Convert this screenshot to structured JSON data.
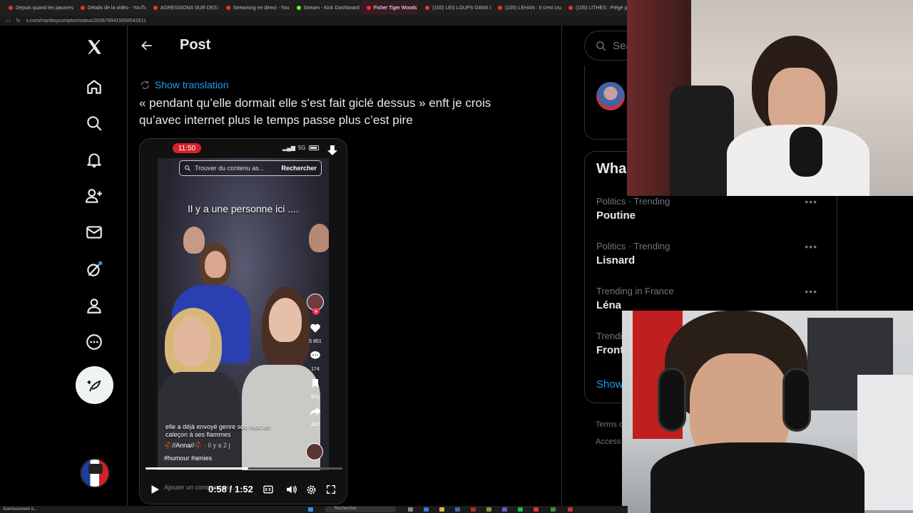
{
  "browser": {
    "tabs": [
      {
        "label": "Depuis quand les pauvres",
        "active": false
      },
      {
        "label": "Détails de la vidéo - YouTu",
        "active": false
      },
      {
        "label": "AGRESSIONS SUR DES E",
        "active": false
      },
      {
        "label": "Streaming en direct - You",
        "active": false
      },
      {
        "label": "Stream - Kick Dashboard",
        "active": false
      },
      {
        "label": "Fisher Tiger Woods",
        "active": true
      },
      {
        "label": "(105) LES LOUPS DANS L",
        "active": false
      },
      {
        "label": "(105) LEHAN : Il s'est cru",
        "active": false
      },
      {
        "label": "(105) LITHÉS : Piégé p",
        "active": false
      }
    ],
    "url": "x.com/manboycompton/status/2036789415058542611"
  },
  "nav": {
    "items": [
      {
        "name": "x-logo-icon"
      },
      {
        "name": "home-icon"
      },
      {
        "name": "search-icon"
      },
      {
        "name": "notifications-icon"
      },
      {
        "name": "follow-icon"
      },
      {
        "name": "messages-icon"
      },
      {
        "name": "grok-icon"
      },
      {
        "name": "profile-icon"
      },
      {
        "name": "more-icon"
      }
    ]
  },
  "post": {
    "header_title": "Post",
    "show_translation": "Show translation",
    "text": "« pendant qu’elle dormait elle s’est fait giclé dessus » enft je crois qu’avec internet plus le temps passe plus c’est pire",
    "video": {
      "status_time": "11:50",
      "network": "5G",
      "search_placeholder": "Trouver du contenu as...",
      "search_button": "Rechercher",
      "caption_top": "Il y a une personne ici ....",
      "caption_bottom": "elle a déjà envoyé genre son mec en caleçon à ses flammes",
      "author": "🥀//Anna//🥀",
      "author_sub": "· Il y a 2 j",
      "tags": "#humour #amies",
      "likes": "5 851",
      "comments": "174",
      "saves": "801",
      "shares": "682",
      "comment_placeholder": "Ajouter un commentaire...",
      "timecode": "0:58 / 1:52",
      "progress": 0.52
    }
  },
  "sidebar": {
    "search_placeholder": "Sea",
    "trends_title": "Wha",
    "trends": [
      {
        "meta": "Politics · Trending",
        "name": "Poutine"
      },
      {
        "meta": "Politics · Trending",
        "name": "Lisnard"
      },
      {
        "meta": "Trending in France",
        "name": "Léna"
      },
      {
        "meta": "Trendi",
        "name": "Front"
      }
    ],
    "show_more": "Show",
    "footer1": "Terms o",
    "footer2": "Access"
  },
  "taskbar": {
    "left_text": "Avertissement d...",
    "search_text": "Rechercher"
  },
  "colors": {
    "accent": "#1d9bf0",
    "background": "#000000",
    "border": "#2f3336"
  }
}
